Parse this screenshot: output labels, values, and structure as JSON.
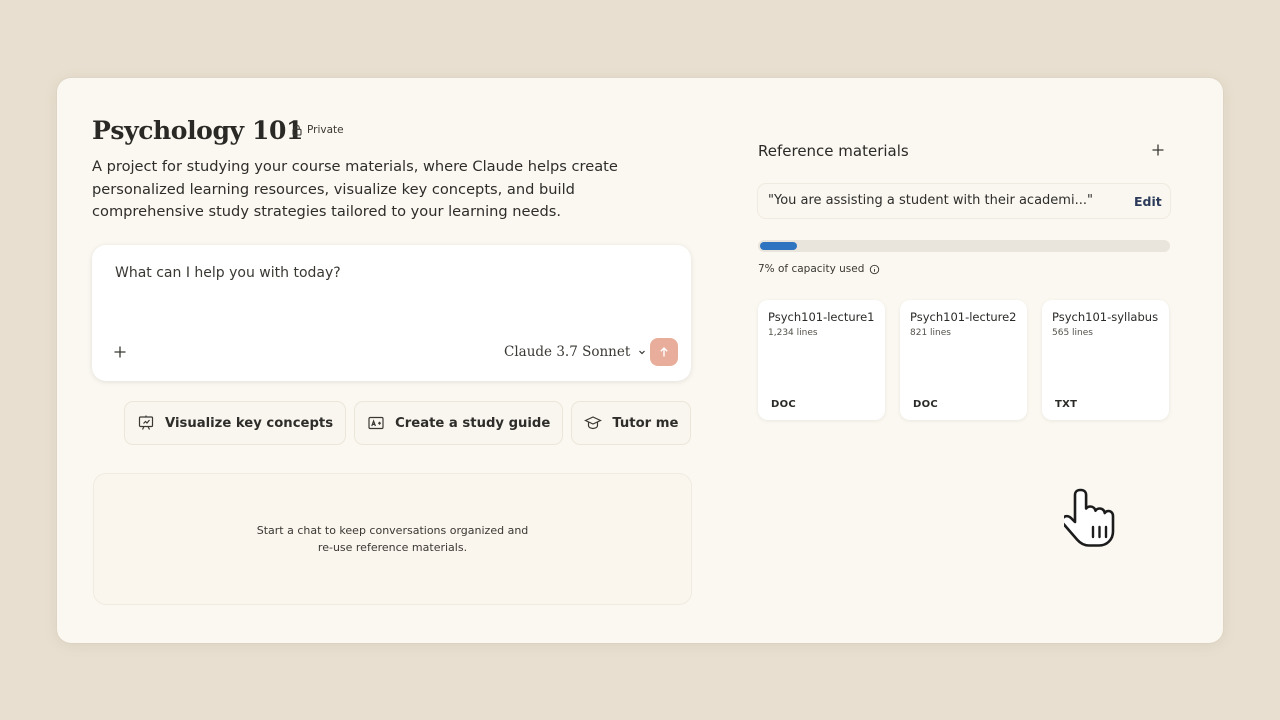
{
  "project": {
    "title": "Psychology 101",
    "visibility": "Private",
    "description": "A project for studying your course materials, where Claude helps create personalized learning resources, visualize key concepts, and build comprehensive study strategies tailored to your learning needs."
  },
  "chat": {
    "placeholder": "What can I help you with today?",
    "model": "Claude 3.7 Sonnet",
    "send_color": "#e9ad9c"
  },
  "actions": [
    {
      "label": "Visualize key concepts",
      "icon": "presentation-chart-icon"
    },
    {
      "label": "Create a study guide",
      "icon": "grade-icon"
    },
    {
      "label": "Tutor me",
      "icon": "graduation-cap-icon"
    }
  ],
  "empty_state": {
    "line1": "Start a chat to keep conversations organized and",
    "line2": "re-use reference materials."
  },
  "reference": {
    "title": "Reference materials",
    "instructions": "\"You are assisting a student with their academi...\"",
    "edit_label": "Edit",
    "capacity_label": "7% of capacity used",
    "capacity_fraction": 0.07,
    "capacity_color": "#2f74c0",
    "files": [
      {
        "name": "Psych101-lecture1",
        "lines": "1,234 lines",
        "type": "DOC"
      },
      {
        "name": "Psych101-lecture2",
        "lines": "821 lines",
        "type": "DOC"
      },
      {
        "name": "Psych101-syllabus",
        "lines": "565 lines",
        "type": "TXT"
      }
    ]
  },
  "colors": {
    "background": "#e8dfd0",
    "panel": "#fbf8f1",
    "accent_link": "#2c3b5a"
  }
}
